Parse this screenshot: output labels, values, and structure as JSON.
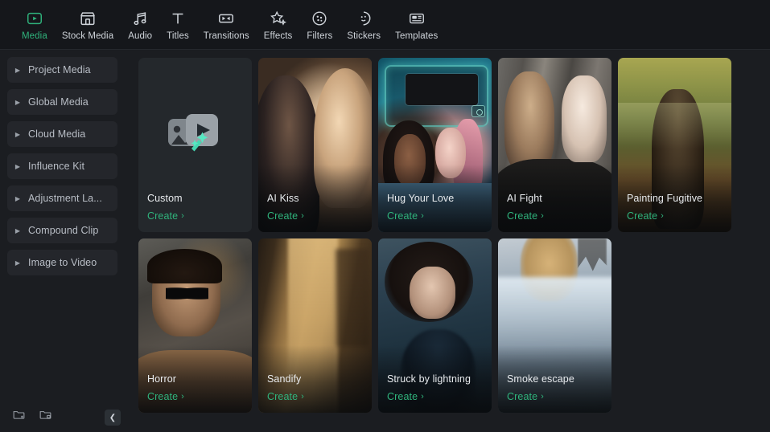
{
  "toolbar": {
    "items": [
      {
        "label": "Media",
        "icon": "media-icon",
        "active": true
      },
      {
        "label": "Stock Media",
        "icon": "store-icon",
        "active": false
      },
      {
        "label": "Audio",
        "icon": "music-note-icon",
        "active": false
      },
      {
        "label": "Titles",
        "icon": "text-t-icon",
        "active": false
      },
      {
        "label": "Transitions",
        "icon": "transition-icon",
        "active": false
      },
      {
        "label": "Effects",
        "icon": "sparkle-star-icon",
        "active": false
      },
      {
        "label": "Filters",
        "icon": "filter-circle-icon",
        "active": false
      },
      {
        "label": "Stickers",
        "icon": "sticker-face-icon",
        "active": false
      },
      {
        "label": "Templates",
        "icon": "template-icon",
        "active": false
      }
    ]
  },
  "sidebar": {
    "items": [
      {
        "label": "Project Media"
      },
      {
        "label": "Global Media"
      },
      {
        "label": "Cloud Media"
      },
      {
        "label": "Influence Kit"
      },
      {
        "label": "Adjustment La..."
      },
      {
        "label": "Compound Clip"
      },
      {
        "label": "Image to Video"
      }
    ],
    "footer": {
      "import_folder_label": "",
      "new_folder_label": "",
      "collapse_label": ""
    }
  },
  "content": {
    "create_label": "Create",
    "chevron": "›",
    "cards": [
      {
        "title": "Custom",
        "art": "custom",
        "create": "Create"
      },
      {
        "title": "AI Kiss",
        "art": "kiss",
        "create": "Create"
      },
      {
        "title": "Hug Your Love",
        "art": "hug",
        "create": "Create"
      },
      {
        "title": "AI Fight",
        "art": "fight",
        "create": "Create"
      },
      {
        "title": "Painting Fugitive",
        "art": "paint",
        "create": "Create"
      },
      {
        "title": "Horror",
        "art": "horror",
        "create": "Create"
      },
      {
        "title": "Sandify",
        "art": "sand",
        "create": "Create"
      },
      {
        "title": "Struck by lightning",
        "art": "struck",
        "create": "Create"
      },
      {
        "title": "Smoke escape",
        "art": "smoke",
        "create": "Create"
      }
    ]
  },
  "colors": {
    "accent_green": "#2fb37c",
    "background": "#1b1d21",
    "toolbar_background": "#15171b",
    "card_placeholder": "#262a2e",
    "text_primary": "#e8ebee",
    "text_secondary": "#b9bec6"
  }
}
